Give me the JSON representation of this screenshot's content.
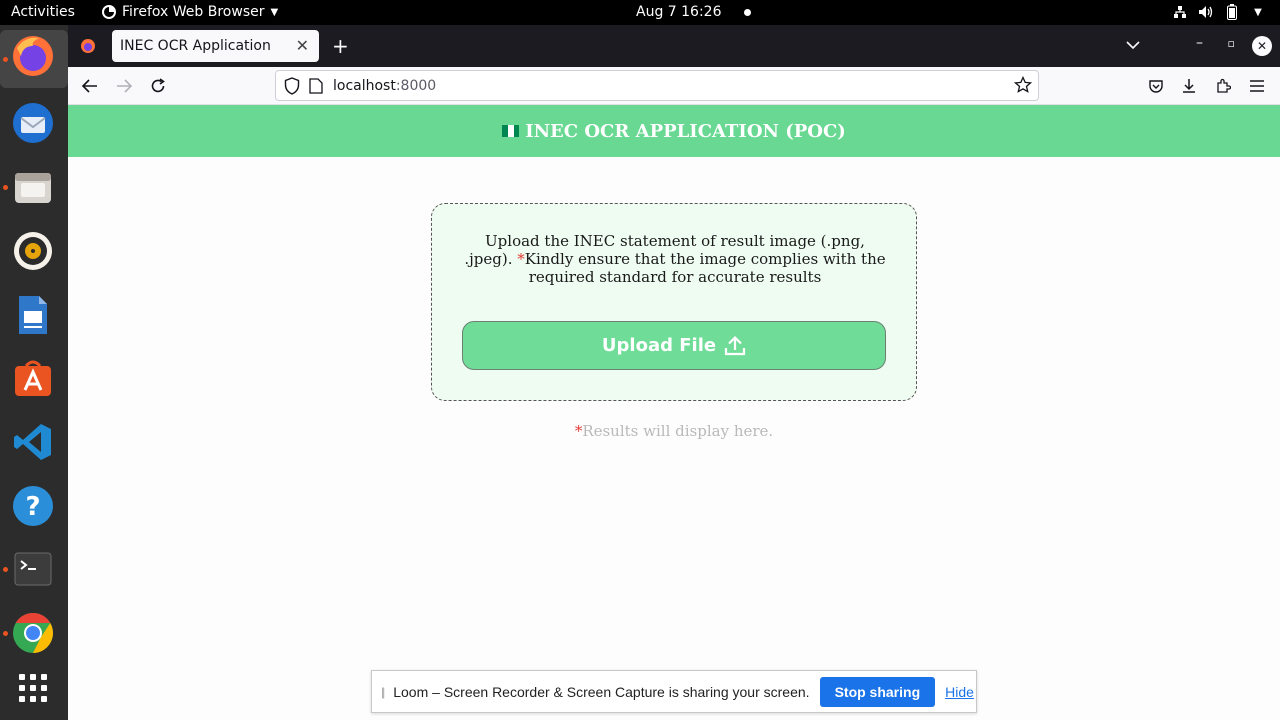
{
  "topbar": {
    "activities": "Activities",
    "app_name": "Firefox Web Browser",
    "clock": "Aug 7  16:26"
  },
  "dock": {
    "items": [
      "firefox",
      "thunderbird",
      "files",
      "rhythmbox",
      "libreoffice-writer",
      "app-center",
      "vscode",
      "help",
      "terminal",
      "chrome",
      "show-apps"
    ]
  },
  "browser": {
    "tab_title": "INEC OCR Application",
    "url_host": "localhost",
    "url_port": ":8000"
  },
  "page": {
    "header_title": "INEC OCR APPLICATION (POC)",
    "upload_text_before": "Upload the INEC statement of result image (.png, .jpeg). ",
    "upload_star": "*",
    "upload_text_after": "Kindly ensure that the image complies with the required standard for accurate results",
    "upload_button": "Upload File",
    "results_star": "*",
    "results_placeholder": "Results will display here."
  },
  "loom": {
    "message": "Loom – Screen Recorder & Screen Capture is sharing your screen.",
    "stop_label": "Stop sharing",
    "hide_label": "Hide"
  },
  "colors": {
    "header_green": "#68d892",
    "card_bg": "#effcf2",
    "button_green": "#6fdc98",
    "accent_blue": "#1a73e8"
  }
}
